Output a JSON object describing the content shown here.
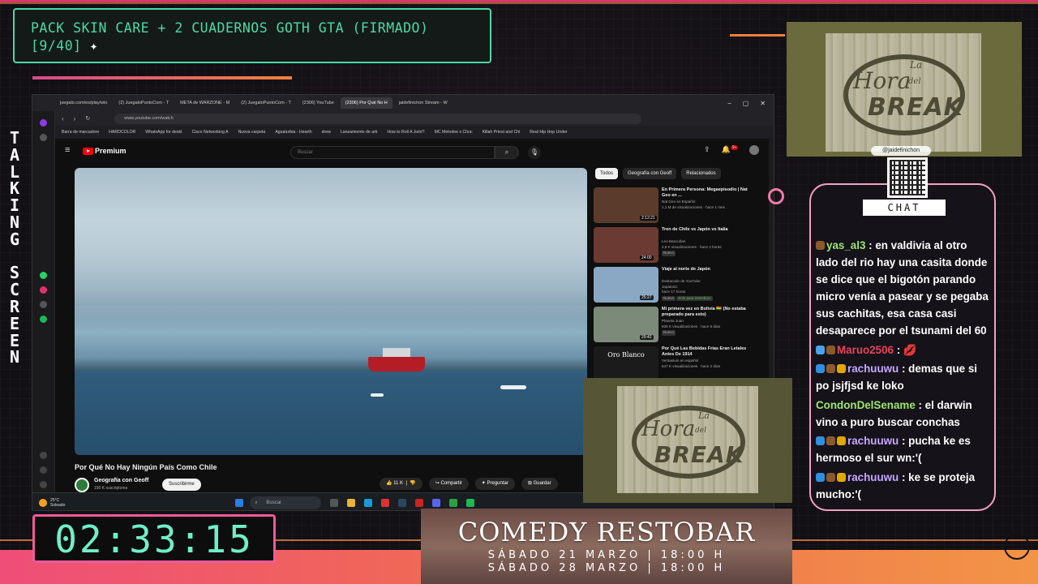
{
  "goal": {
    "line1": "PACK SKIN CARE + 2 CUADERNOS GOTH GTA (FIRMADO)",
    "line2": "[9/40]",
    "spark": "✦"
  },
  "vertical_label": [
    "T",
    "A",
    "L",
    "K",
    "I",
    "N",
    "G",
    " ",
    "S",
    "C",
    "R",
    "E",
    "E",
    "N"
  ],
  "browser": {
    "tabs": [
      "juegalo.com/es/play/win",
      "(2) JuegaloPuntoCom - T",
      "META de WARZONE - M",
      "(2) JuegaloPuntoCom - T",
      "(2306) YouTube",
      "(2306) Por Qué No H",
      "jaidefinichon Stream - W"
    ],
    "window_controls": [
      "−",
      "▢",
      "✕"
    ],
    "url": "www.youtube.com/watch",
    "bookmarks": [
      "Barra de marcadore",
      "HARDCOLOR",
      "WhatsApp for deskt",
      "Cisco Networking A",
      "Nueva carpeta",
      "Aguaturbia - Hearth",
      "drew",
      "Lanzamiento de arti",
      "How to Roll A Joint?",
      "MC Melodee x Chuc",
      "Killah Priest and Chi",
      "Real Hip Hop Under"
    ]
  },
  "youtube": {
    "logo": "Premium",
    "search_placeholder": "Buscar",
    "notif_count": "9+",
    "video_title": "Por Qué No Hay Ningún País Como Chile",
    "channel": "Geografía con Geoff",
    "subs": "190 K suscriptores",
    "subscribe": "Suscribirme",
    "actions": {
      "likes": "11 K",
      "share": "Compartir",
      "ask": "Preguntar",
      "save": "Guardar"
    },
    "chips": [
      "Todos",
      "Geografía con Geoff",
      "Relacionados"
    ],
    "recommendations": [
      {
        "title": "En Primera Persona: Megaepisodio | Nat Geo en ...",
        "channel": "Nat Geo en Español",
        "meta": "1,1 M de visualizaciones · hace 1 mes",
        "duration": "2:12:21",
        "color": "#5a3b2c"
      },
      {
        "title": "Tren de Chile vs Japón vs Italia",
        "channel": "Leo Bascuñan",
        "meta": "4,8 K visualizaciones · hace 2 horas",
        "duration": "24:00",
        "badge": "Nuevo",
        "color": "#6b3a32"
      },
      {
        "title": "Viaje al norte de Japón",
        "channel": "Japatonic",
        "meta": "hace 17 horas",
        "extra": "Destacado de YouTube",
        "badge": "Nuevo",
        "badge2": "Solo para miembros",
        "duration": "25:27",
        "color": "#8aa8c4"
      },
      {
        "title": "Mi primera vez en Bolivia 🇧🇴 (No estaba preparado para esto)",
        "channel": "Planeta Juan",
        "meta": "835 K visualizaciones · hace 6 días",
        "duration": "29:42",
        "badge": "Nuevo",
        "color": "#7c8a7a"
      },
      {
        "title": "Por Qué Las Bebidas Frías Eran Letales Antes De 1914",
        "channel": "Veritasium en español",
        "meta": "647 K visualizaciones · hace 2 días",
        "duration": "",
        "thumb_text": "Oro Blanco",
        "color": "#1b1b1b"
      }
    ]
  },
  "taskbar": {
    "temp": "25°C",
    "condition": "Soleado",
    "search": "Buscar"
  },
  "logo": {
    "top": "La",
    "hora": "Hora",
    "del": "del",
    "main": "BREAK"
  },
  "qr_handle": "@jaidefinichon",
  "chat_label": "CHAT",
  "chat": [
    {
      "user": "yas_al3",
      "color": "#9be86c",
      "badges": [
        "#8a5a2b"
      ],
      "text": "en valdivia al otro lado del rio hay una casita donde se dice que el bigotón parando micro venía a pasear y se pegaba sus cachitas, esa casa casi desaparece por el tsunami del 60"
    },
    {
      "user": "Maruo2506",
      "color": "#e8435a",
      "badges": [
        "#4aa3e8",
        "#8a5a2b"
      ],
      "text": "💋"
    },
    {
      "user": "rachuuwu",
      "color": "#c7a6ff",
      "badges": [
        "#2f8fe0",
        "#8a5a2b",
        "#e0a800"
      ],
      "text": "demas que si po jsjfjsd ke loko"
    },
    {
      "user": "CondonDelSename",
      "color": "#9be86c",
      "badges": [],
      "text": "el darwin vino a puro buscar conchas"
    },
    {
      "user": "rachuuwu",
      "color": "#c7a6ff",
      "badges": [
        "#2f8fe0",
        "#8a5a2b",
        "#e0a800"
      ],
      "text": "pucha ke es hermoso el sur wn:'("
    },
    {
      "user": "rachuuwu",
      "color": "#c7a6ff",
      "badges": [
        "#2f8fe0",
        "#8a5a2b",
        "#e0a800"
      ],
      "text": "ke se proteja mucho:'("
    }
  ],
  "timer": "02:33:15",
  "comedy": {
    "title": "COMEDY RESTOBAR",
    "date1": "SÁBADO 21 MARZO | 18:00 H",
    "date2": "SÁBADO 28 MARZO | 18:00 H"
  }
}
